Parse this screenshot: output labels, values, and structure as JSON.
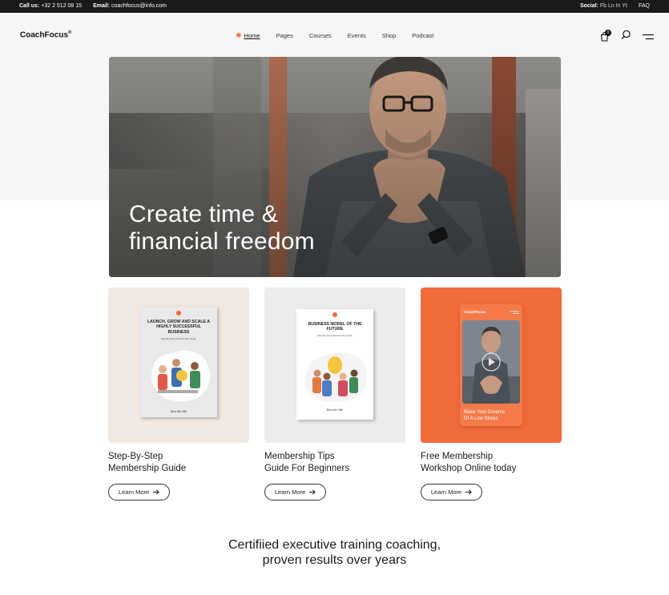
{
  "topbar": {
    "call_label": "Call us:",
    "call_value": "+32 2 512 08 15",
    "email_label": "Email:",
    "email_value": "coachfocus@info.com",
    "social_label": "Social:",
    "social_value": "Fb Ln In Yt",
    "faq": "FAQ"
  },
  "header": {
    "logo": "CoachFocus",
    "logo_mark": "®",
    "nav": [
      "Home",
      "Pages",
      "Courses",
      "Events",
      "Shop",
      "Podcast"
    ],
    "active_nav": "Home",
    "cart_count": "0",
    "icons": [
      "cart-icon",
      "search-icon",
      "menu-icon"
    ]
  },
  "hero": {
    "line1": "Create time &",
    "line2": "financial freedom"
  },
  "cards": [
    {
      "title_line1": "Step-By-Step",
      "title_line2": "Membership Guide",
      "button": "Learn More",
      "book_title": "LAUNCH, GROW AND SCALE A HIGHLY SUCCESSFUL BUSINESS",
      "book_sub": "Step By Step Membership Guide",
      "book_author": "Ben Mc Nill",
      "bg": "#f1e8e1"
    },
    {
      "title_line1": "Membership Tips",
      "title_line2": "Guide For Beginners",
      "button": "Learn More",
      "book_title": "BUSINESS MODEL OF THE FUTURE",
      "book_sub": "Step By Step Membership Guide",
      "book_author": "Ben Mc Nill",
      "bg": "#ececec"
    },
    {
      "title_line1": "Free Membership",
      "title_line2": "Workshop Online today",
      "button": "Learn More",
      "phone_logo": "CoachFocus",
      "phone_text_line1": "Make Your Dreams",
      "phone_text_line2": "Of A Low Stress",
      "bg": "#f26b3a"
    }
  ],
  "bottom": {
    "line1": "Certifiied executive training coaching,",
    "line2": "proven results over years"
  },
  "colors": {
    "accent": "#f26b3a",
    "dark": "#1a1a1a"
  }
}
